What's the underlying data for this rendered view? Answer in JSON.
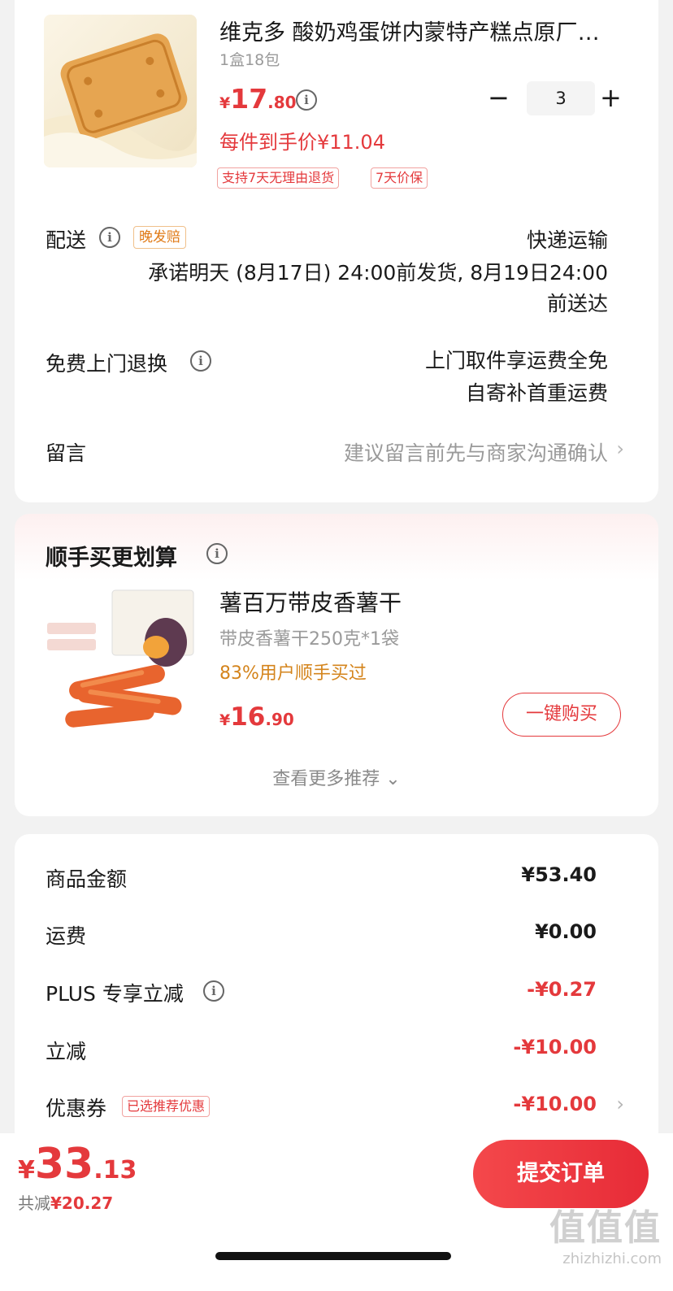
{
  "product": {
    "title": "维克多 酸奶鸡蛋饼内蒙特产糕点原厂…",
    "spec": "1盒18包",
    "price_symbol": "¥",
    "price_int": "17",
    "price_dec": ".80",
    "final_price": "每件到手价¥11.04",
    "quantity": "3",
    "minus": "−",
    "plus": "+",
    "tags": [
      "支持7天无理由退货",
      "7天价保"
    ]
  },
  "delivery": {
    "label": "配送",
    "late_tag": "晚发赔",
    "method": "快递运输",
    "promise_line1": "承诺明天 (8月17日) 24:00前发货, 8月19日24:00",
    "promise_line2": "前送达"
  },
  "free_return": {
    "label": "免费上门退换",
    "line1": "上门取件享运费全免",
    "line2": "自寄补首重运费"
  },
  "message": {
    "label": "留言",
    "placeholder": "建议留言前先与商家沟通确认"
  },
  "recommend": {
    "heading": "顺手买更划算",
    "item_title": "薯百万带皮香薯干",
    "item_spec": "带皮香薯干250克*1袋",
    "item_pct": "83%用户顺手买过",
    "price_symbol": "¥",
    "price_int": "16",
    "price_dec": ".90",
    "buy_label": "一键购买",
    "more_label": "查看更多推荐 ⌄"
  },
  "summary": {
    "rows": [
      {
        "label": "商品金额",
        "value": "¥53.40"
      },
      {
        "label": "运费",
        "value": "¥0.00"
      },
      {
        "label": "PLUS 专享立减",
        "value": "-¥0.27"
      },
      {
        "label": "立减",
        "value": "-¥10.00"
      },
      {
        "label": "优惠券",
        "value": "-¥10.00"
      }
    ],
    "coupon_tag": "已选推荐优惠"
  },
  "bottom": {
    "total_symbol": "¥",
    "total_int": "33",
    "total_dec": ".13",
    "save_label": "共减",
    "save_value": "¥20.27",
    "submit_label": "提交订单"
  },
  "watermark": {
    "text": "值值值",
    "sub": "zhizhizhi.com"
  },
  "colors": {
    "accent": "#e4393c",
    "orange": "#d4841c",
    "tag_orange": "#e07a16"
  },
  "icons": [
    "info-icon",
    "chevron-right-icon",
    "chevron-down-icon",
    "minus-icon",
    "plus-icon"
  ]
}
